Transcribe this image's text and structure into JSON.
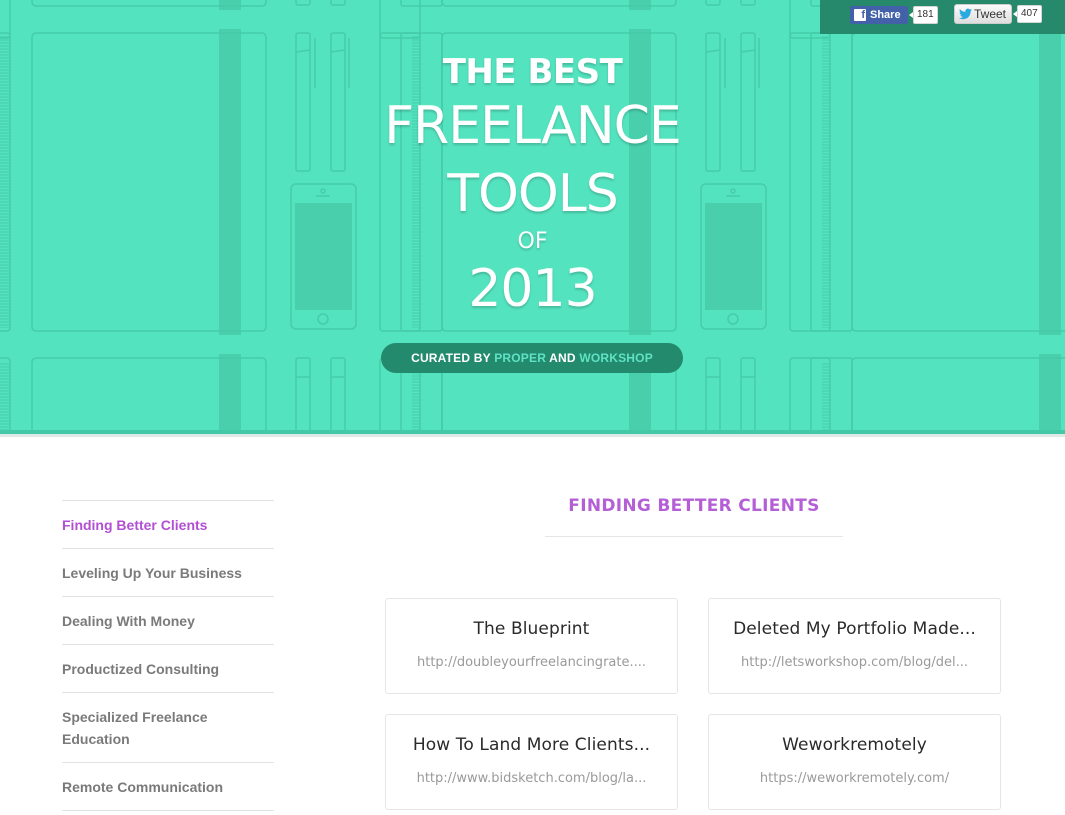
{
  "hero": {
    "title_line1": "THE BEST",
    "title_line2": "FREELANCE",
    "title_line3": "TOOLS",
    "title_line4": "OF",
    "title_line5": "2013",
    "curated": {
      "prefix": "CURATED BY ",
      "brand1": "PROPER",
      "joiner": " AND ",
      "brand2": "WORKSHOP"
    },
    "colors": {
      "background": "#54e3bf",
      "pill": "#238a6d",
      "highlight": "#5fe3c3"
    }
  },
  "social": {
    "facebook": {
      "label": "Share",
      "icon": "facebook-icon",
      "count": "181"
    },
    "twitter": {
      "label": "Tweet",
      "icon": "twitter-bird-icon",
      "count": "407"
    }
  },
  "sidebar": {
    "items": [
      {
        "label": "Finding Better Clients",
        "active": true
      },
      {
        "label": "Leveling Up Your Business",
        "active": false
      },
      {
        "label": "Dealing With Money",
        "active": false
      },
      {
        "label": "Productized Consulting",
        "active": false
      },
      {
        "label": "Specialized Freelance Education",
        "active": false
      },
      {
        "label": "Remote Communication",
        "active": false
      }
    ]
  },
  "main": {
    "section_title": "FINDING BETTER CLIENTS",
    "accent_color": "#b55fd6",
    "cards": [
      {
        "title": "The Blueprint",
        "url": "http://doubleyourfreelancingrate...."
      },
      {
        "title": "Deleted My Portfolio Made...",
        "url": "http://letsworkshop.com/blog/del..."
      },
      {
        "title": "How To Land More Clients...",
        "url": "http://www.bidsketch.com/blog/la..."
      },
      {
        "title": "Weworkremotely",
        "url": "https://weworkremotely.com/"
      }
    ]
  }
}
